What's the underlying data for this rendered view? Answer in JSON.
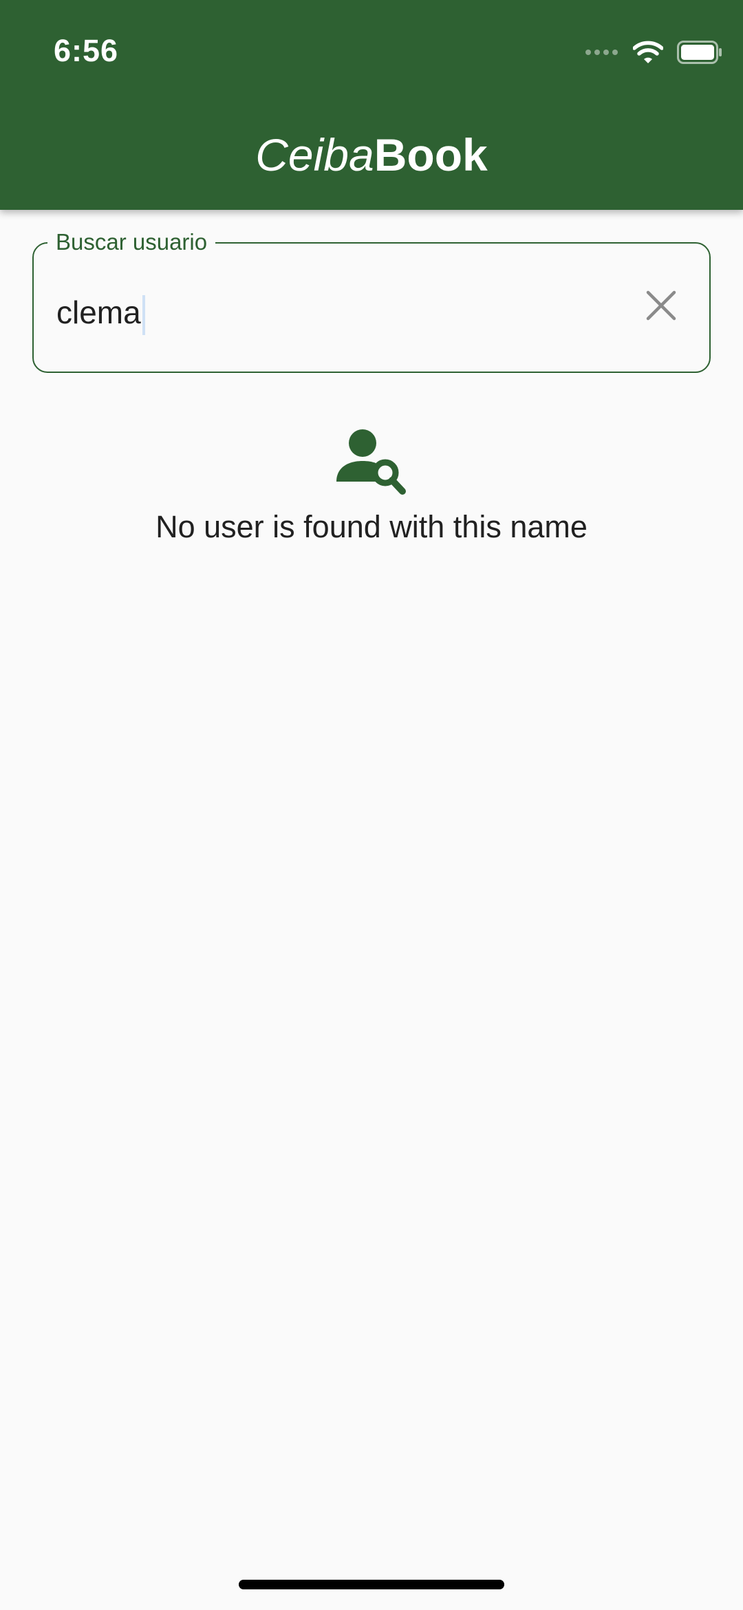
{
  "status_bar": {
    "time": "6:56",
    "icons": [
      "cellular-signal-icon",
      "wifi-icon",
      "battery-icon"
    ]
  },
  "app_bar": {
    "title_italic": "Ceiba",
    "title_bold": "Book",
    "background_color": "#2e6132"
  },
  "search": {
    "label": "Buscar usuario",
    "value": "clema",
    "clear_icon": "close-icon"
  },
  "empty_state": {
    "icon": "person-search-icon",
    "message": "No user is found with this name"
  },
  "colors": {
    "primary": "#2e6132",
    "background": "#fafafa",
    "text": "#212121"
  }
}
